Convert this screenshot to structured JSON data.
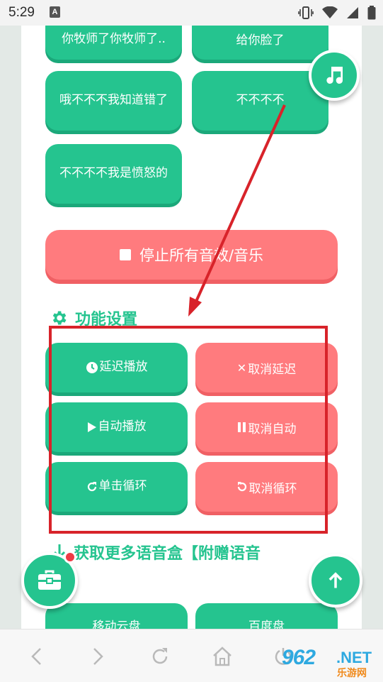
{
  "status_bar": {
    "time": "5:29",
    "a_icon": "A"
  },
  "sound_buttons": [
    {
      "label": "你牧师了你牧师了.."
    },
    {
      "label": "给你脸了"
    },
    {
      "label": "哦不不不我知道错了"
    },
    {
      "label": "不不不不"
    },
    {
      "label": "不不不不我是愤怒的"
    }
  ],
  "stop_button": {
    "label": "停止所有音效/音乐"
  },
  "settings_section": {
    "title": "功能设置",
    "buttons": [
      {
        "label": "延迟播放",
        "icon": "clock-icon"
      },
      {
        "label": "取消延迟",
        "icon": "x-icon"
      },
      {
        "label": "自动播放",
        "icon": "play-icon"
      },
      {
        "label": "取消自动",
        "icon": "pause-icon"
      },
      {
        "label": "单击循环",
        "icon": "redo-icon"
      },
      {
        "label": "取消循环",
        "icon": "undo-icon"
      }
    ]
  },
  "more_section": {
    "title": "获取更多语音盒【附赠语音"
  },
  "bottom_buttons": [
    {
      "label": "移动云盘"
    },
    {
      "label": "百度盘"
    }
  ],
  "fabs": {
    "music": "music-note-icon",
    "toolbox": "toolbox-icon",
    "top": "arrow-up-icon"
  },
  "watermark": {
    "number": "962",
    "suffix": ".NET",
    "site": "乐游网"
  },
  "colors": {
    "green": "#25c48f",
    "red": "#ff7b7e",
    "highlight": "#d8232a"
  }
}
